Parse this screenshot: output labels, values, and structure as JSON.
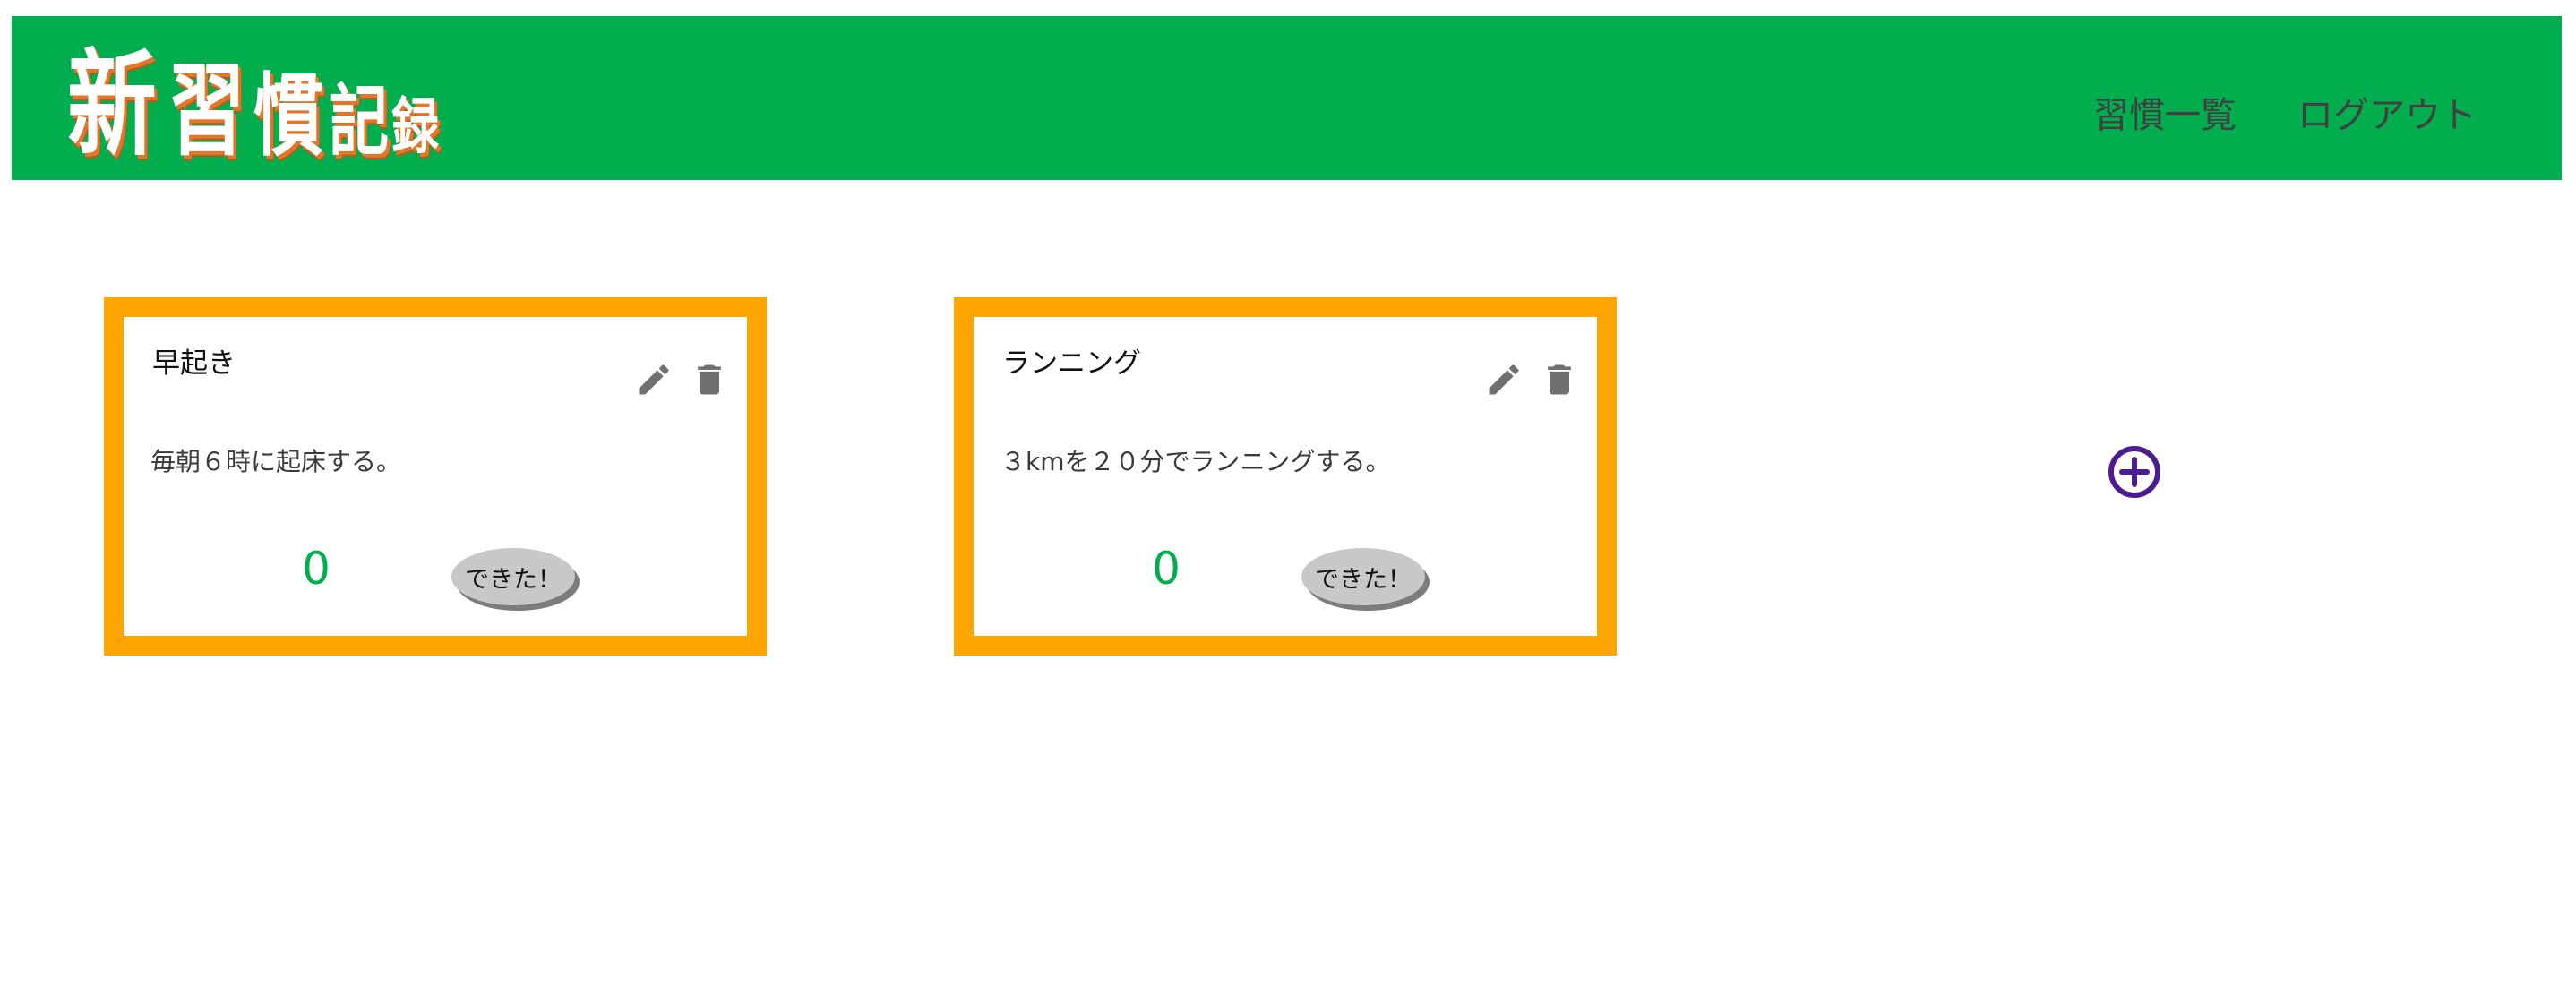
{
  "header": {
    "logo_chars": [
      "新",
      "習",
      "慣",
      "記",
      "録"
    ],
    "nav": {
      "habit_list": "習慣一覧",
      "logout": "ログアウト"
    }
  },
  "habits": [
    {
      "title": "早起き",
      "description": "毎朝６時に起床する。",
      "count": "0",
      "done_label": "できた！"
    },
    {
      "title": "ランニング",
      "description": "３kmを２０分でランニングする。",
      "count": "0",
      "done_label": "できた！"
    }
  ],
  "icons": {
    "edit": "pencil-icon",
    "delete": "trash-icon",
    "add": "plus-circle-icon"
  },
  "colors": {
    "header_bg": "#00ae4e",
    "card_border": "#ffa500",
    "count": "#00ae4e",
    "add_icon": "#4b1d8f",
    "icon_gray": "#707070"
  }
}
